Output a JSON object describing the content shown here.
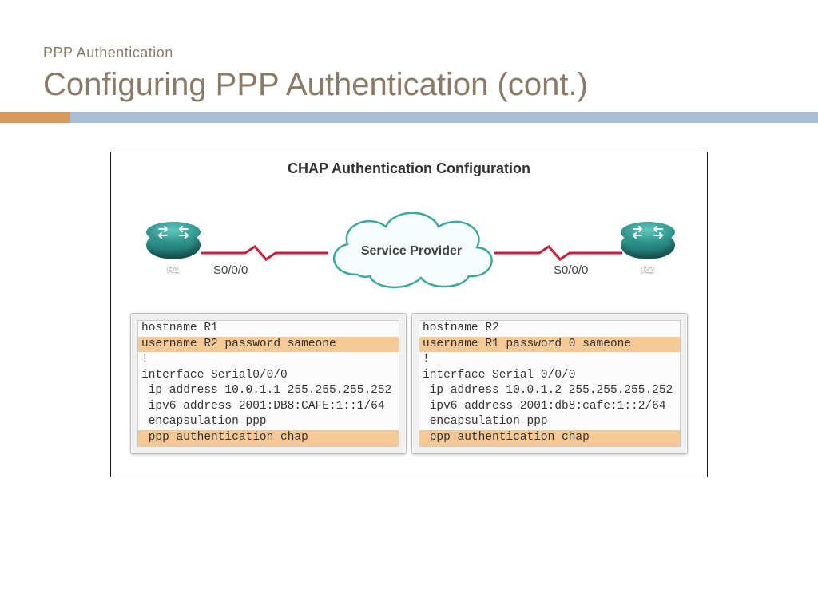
{
  "header": {
    "subtitle": "PPP Authentication",
    "title": "Configuring PPP Authentication (cont.)"
  },
  "diagram": {
    "title": "CHAP Authentication Configuration",
    "cloud_label": "Service Provider",
    "routers": {
      "left": {
        "name": "R1",
        "interface": "S0/0/0"
      },
      "right": {
        "name": "R2",
        "interface": "S0/0/0"
      }
    },
    "configs": {
      "left": [
        {
          "text": "hostname R1",
          "hl": false
        },
        {
          "text": "username R2 password sameone",
          "hl": true
        },
        {
          "text": "!",
          "hl": false
        },
        {
          "text": "interface Serial0/0/0",
          "hl": false
        },
        {
          "text": " ip address 10.0.1.1 255.255.255.252",
          "hl": false
        },
        {
          "text": " ipv6 address 2001:DB8:CAFE:1::1/64",
          "hl": false
        },
        {
          "text": " encapsulation ppp",
          "hl": false
        },
        {
          "text": " ppp authentication chap",
          "hl": true
        }
      ],
      "right": [
        {
          "text": "hostname R2",
          "hl": false
        },
        {
          "text": "username R1 password 0 sameone",
          "hl": true
        },
        {
          "text": "!",
          "hl": false
        },
        {
          "text": "interface Serial 0/0/0",
          "hl": false
        },
        {
          "text": " ip address 10.0.1.2 255.255.255.252",
          "hl": false
        },
        {
          "text": " ipv6 address 2001:db8:cafe:1::2/64",
          "hl": false
        },
        {
          "text": " encapsulation ppp",
          "hl": false
        },
        {
          "text": " ppp authentication chap",
          "hl": true
        }
      ]
    }
  }
}
